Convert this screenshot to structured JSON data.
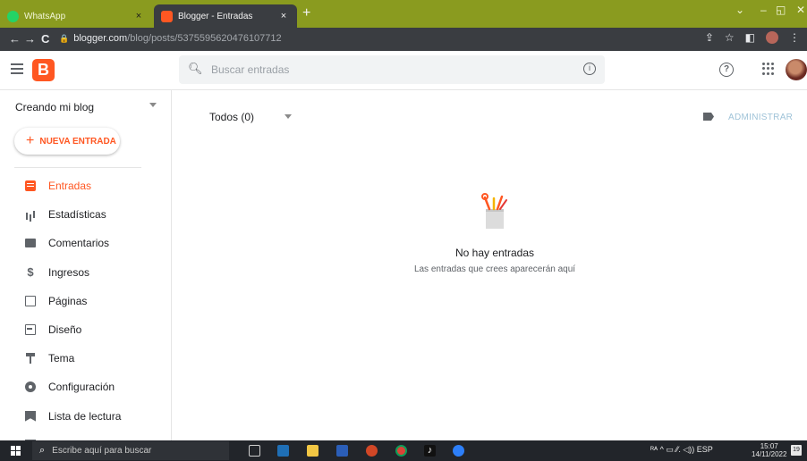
{
  "browser": {
    "tabs": [
      {
        "label": "WhatsApp",
        "close": "×"
      },
      {
        "label": "Blogger - Entradas",
        "close": "×"
      }
    ],
    "new_tab": "+",
    "window_controls": {
      "chevron": "⌄",
      "minimize": "–",
      "restore": "◱",
      "close": "✕"
    },
    "nav": {
      "back": "←",
      "forward": "→",
      "reload": "C"
    },
    "url": {
      "domain": "blogger.com",
      "path": "/blog/posts/5375595620476107712"
    }
  },
  "header": {
    "logo_letter": "B",
    "search_placeholder": "Buscar entradas",
    "help_glyph": "?",
    "info_glyph": "i"
  },
  "sidebar": {
    "blog_name": "Creando mi blog",
    "new_post": {
      "plus": "+",
      "label": "NUEVA ENTRADA"
    },
    "items": [
      {
        "label": "Entradas",
        "icon": "posts-icon",
        "active": true
      },
      {
        "label": "Estadísticas",
        "icon": "stats-icon",
        "active": false
      },
      {
        "label": "Comentarios",
        "icon": "comments-icon",
        "active": false
      },
      {
        "label": "Ingresos",
        "icon": "dollar-icon",
        "active": false
      },
      {
        "label": "Páginas",
        "icon": "pages-icon",
        "active": false
      },
      {
        "label": "Diseño",
        "icon": "layout-icon",
        "active": false
      },
      {
        "label": "Tema",
        "icon": "theme-icon",
        "active": false
      },
      {
        "label": "Configuración",
        "icon": "gear-icon",
        "active": false
      },
      {
        "label": "Lista de lectura",
        "icon": "bookmark-icon",
        "active": false
      }
    ]
  },
  "main": {
    "filter_label": "Todos (0)",
    "manage_label": "ADMINISTRAR",
    "empty_title": "No hay entradas",
    "empty_subtitle": "Las entradas que crees aparecerán aquí"
  },
  "taskbar": {
    "search_placeholder": "Escribe aquí para buscar",
    "tray_text": "ᴿᴬ  ^  ▭  ⁄⁄.  ◁))  ESP",
    "time": "15:07",
    "date": "14/11/2022",
    "notifications": "19"
  },
  "colors": {
    "accent": "#ff5722",
    "tabbar": "#8a9b1f",
    "addressbar": "#3a3d41",
    "taskbar": "#22252a",
    "manage_link": "#9fc3d8"
  }
}
